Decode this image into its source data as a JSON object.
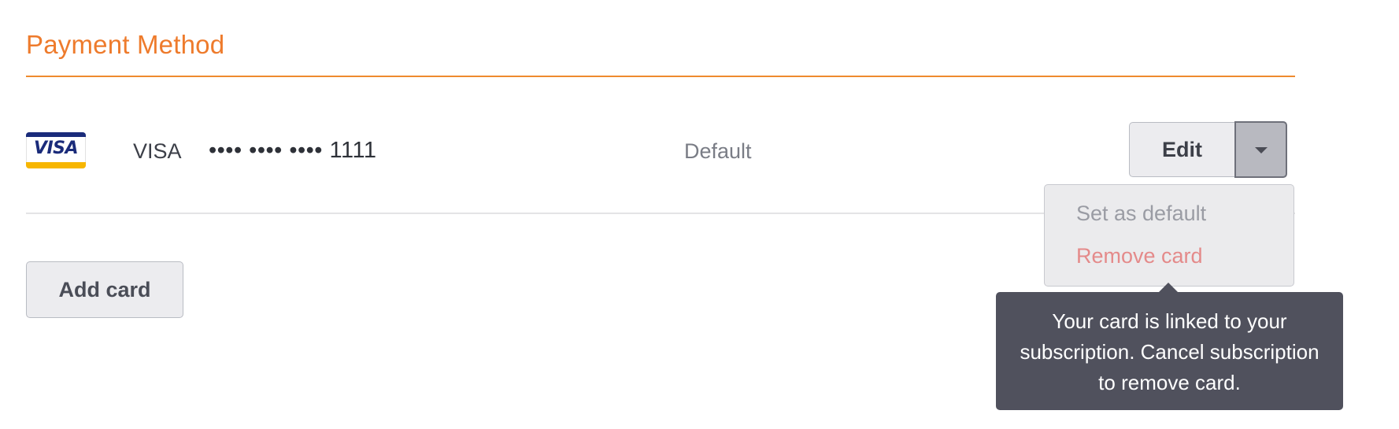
{
  "section": {
    "title": "Payment Method"
  },
  "card": {
    "logo_icon": "visa-logo-icon",
    "logo_text": "VISA",
    "brand": "VISA",
    "masked_number": "•••• •••• •••• 1111",
    "status": "Default"
  },
  "actions": {
    "edit_label": "Edit",
    "dropdown_icon": "caret-down-icon",
    "add_card_label": "Add card"
  },
  "menu": {
    "items": [
      {
        "label": "Set as default",
        "state": "disabled"
      },
      {
        "label": "Remove card",
        "state": "disabled-danger"
      }
    ]
  },
  "tooltip": {
    "text": "Your card is linked to your subscription. Cancel subscription to remove card."
  },
  "colors": {
    "accent": "#ee7b2c",
    "tooltip_bg": "#50515d",
    "danger_muted": "#e48a8a",
    "visa_blue": "#1a2b7a",
    "visa_gold": "#f7b600"
  }
}
